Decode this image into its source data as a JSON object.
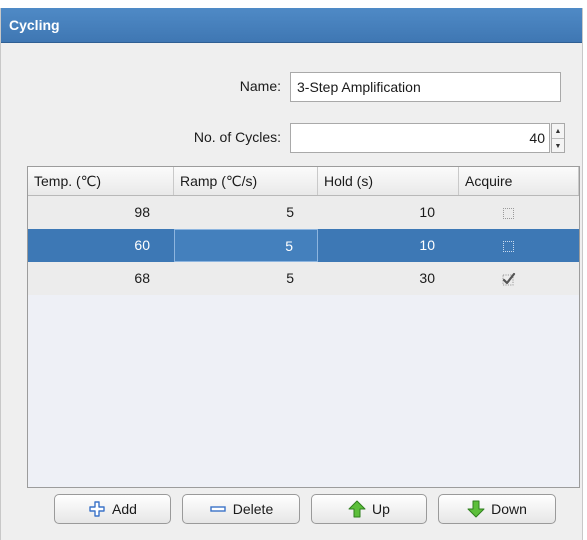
{
  "panel": {
    "title": "Cycling"
  },
  "form": {
    "name_label": "Name:",
    "name_value": "3-Step Amplification",
    "cycles_label": "No. of Cycles:",
    "cycles_value": "40"
  },
  "table": {
    "columns": [
      "Temp. (℃)",
      "Ramp (℃/s)",
      "Hold (s)",
      "Acquire"
    ],
    "rows": [
      {
        "temp": "98",
        "ramp": "5",
        "hold": "10",
        "acquire": false
      },
      {
        "temp": "60",
        "ramp": "5",
        "hold": "10",
        "acquire": false,
        "selected": true
      },
      {
        "temp": "68",
        "ramp": "5",
        "hold": "30",
        "acquire": true
      }
    ]
  },
  "buttons": {
    "add": "Add",
    "delete": "Delete",
    "up": "Up",
    "down": "Down"
  },
  "icons": {
    "add": "plus-icon",
    "delete": "minus-icon",
    "up": "green-arrow-up-icon",
    "down": "green-arrow-down-icon"
  },
  "colors": {
    "title_bar": "#4a84c1",
    "selection": "#3d78b5",
    "icon_blue": "#3b73c8",
    "icon_green": "#3fa62e"
  }
}
